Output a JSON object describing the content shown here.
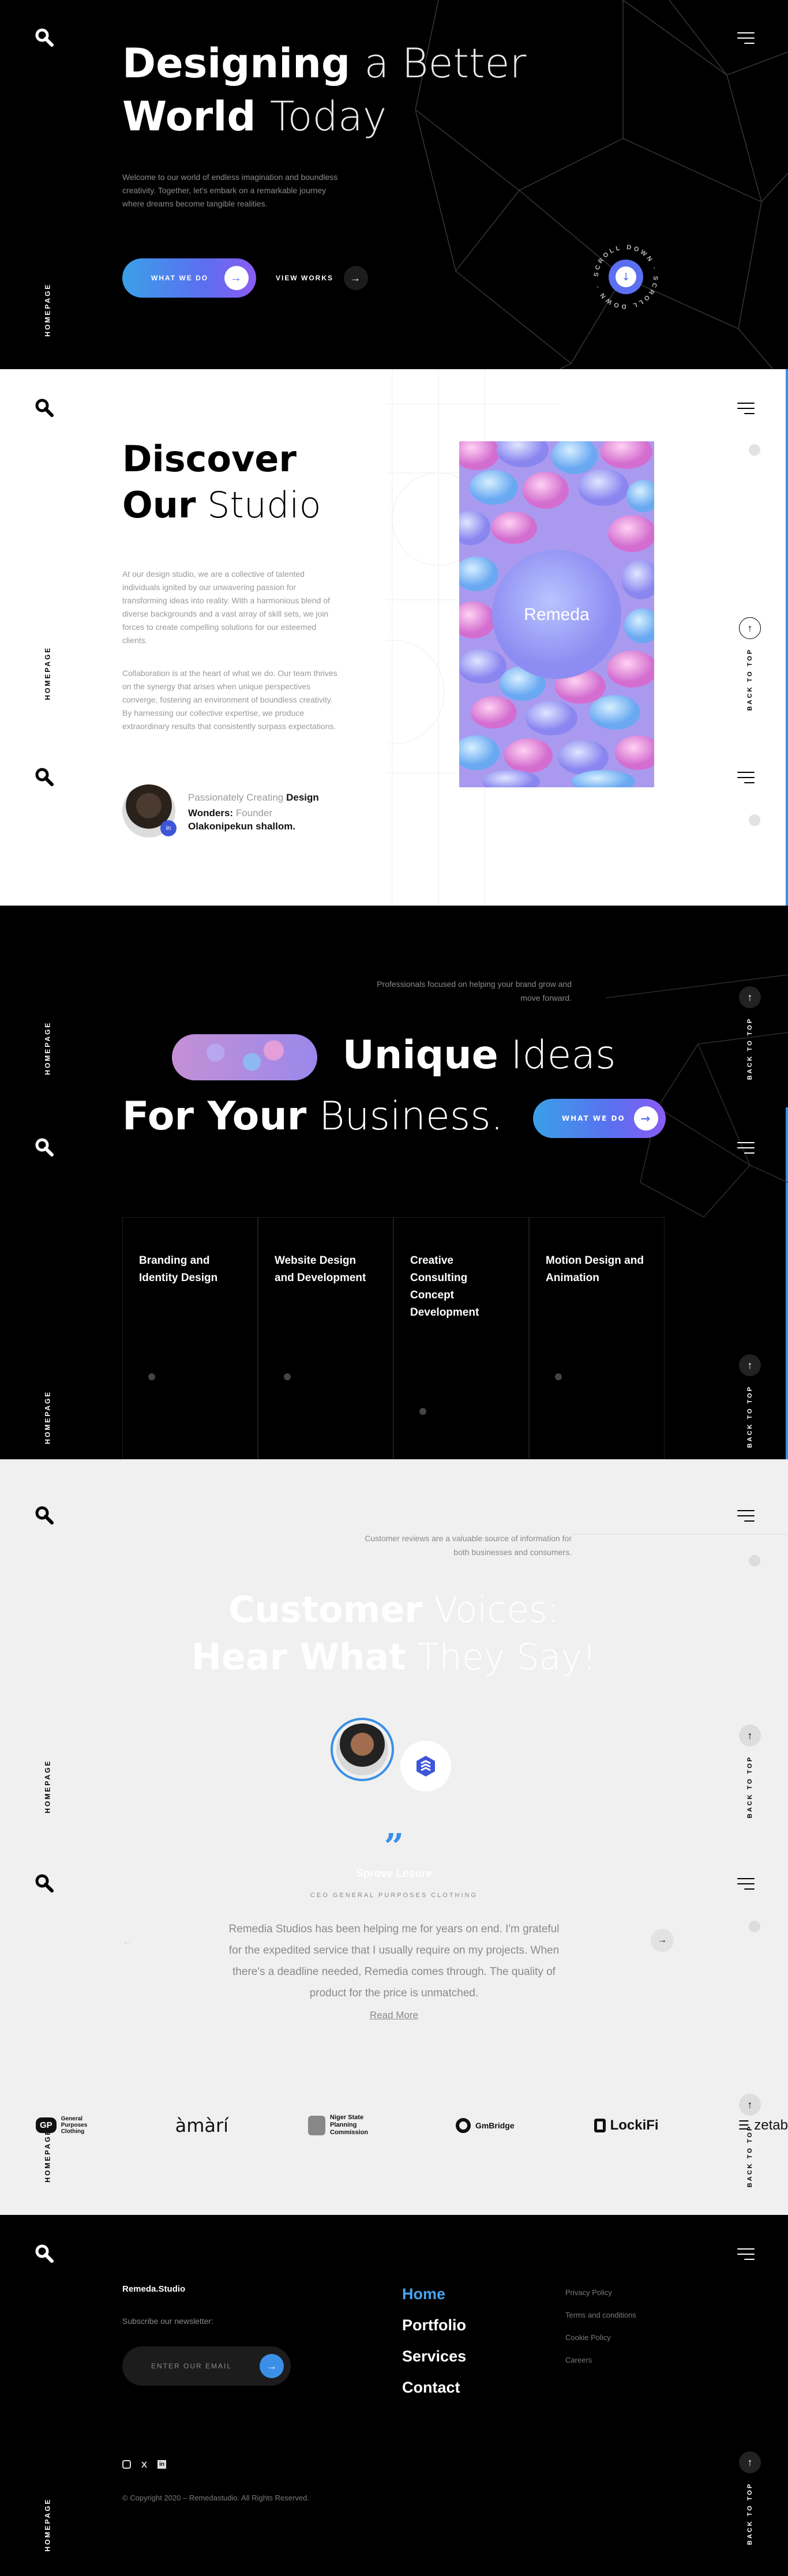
{
  "hero": {
    "title_bold_1": "Designing",
    "title_light_1": "a Better",
    "title_bold_2": "World",
    "title_light_2": "Today",
    "description": "Welcome to our world of endless imagination and boundless creativity. Together, let's embark on a remarkable journey where dreams become tangible realities.",
    "primary_button": "WHAT WE DO",
    "secondary_link": "VIEW WORKS",
    "scroll_badge": "SCROLL DOWN · SCROLL DOWN ·",
    "side_label": "HOMEPAGE"
  },
  "studio": {
    "title_bold_1": "Discover",
    "title_bold_2": "Our",
    "title_light_2": "Studio",
    "para1": "At our design studio, we are a collective of talented individuals ignited by our unwavering passion for transforming ideas into reality. With a harmonious blend of diverse backgrounds and a vast array of skill sets, we join forces to create compelling solutions for our esteemed clients.",
    "para2": "Collaboration is at the heart of what we do. Our team thrives on the synergy that arises when unique perspectives converge, fostering an environment of boundless creativity. By harnessing our collective expertise, we produce extraordinary results that consistently surpass expectations.",
    "founder_line_light": "Passionately Creating",
    "founder_line_bold1": "Design",
    "founder_line_bold2": "Wonders:",
    "founder_role": "Founder",
    "founder_name": "Olakonipekun shallom.",
    "founder_badge": "in",
    "product_brand": "Remeda",
    "side_label": "HOMEPAGE",
    "back_to_top": "BACK TO TOP"
  },
  "services": {
    "note": "Professionals focused on helping your brand grow and move forward.",
    "title_bold_1": "Unique",
    "title_light_1": "Ideas",
    "title_bold_2": "For Your",
    "title_light_2": "Business.",
    "button": "WHAT WE DO",
    "cards": [
      {
        "title": "Branding and Identity Design"
      },
      {
        "title": "Website Design and Development"
      },
      {
        "title": "Creative Consulting Concept Development"
      },
      {
        "title": "Motion Design and Animation"
      }
    ],
    "side_label": "HOMEPAGE",
    "back_to_top": "BACK TO TOP"
  },
  "reviews": {
    "note": "Customer reviews are a valuable source of information for both businesses and consumers.",
    "title_bold_1": "Customer",
    "title_light_1": "Voices:",
    "title_bold_2": "Hear What",
    "title_light_2": "They Say!",
    "quote_mark": "”",
    "name": "Sprove Lesure",
    "role": "CEO GENERAL PURPOSES CLOTHING",
    "quote": "Remedia Studios has been helping me for years on end. I'm grateful for the expedited service that I usually require on my projects. When there's a deadline needed, Remedia comes through. The quality of product for the price is unmatched.",
    "read_more": "Read More",
    "side_label": "HOMEPAGE",
    "back_to_top": "BACK TO TOP"
  },
  "logos": [
    {
      "name": "General Purposes Clothing",
      "mark": "GP"
    },
    {
      "name": "àmàrí",
      "mark": ""
    },
    {
      "name": "Niger State Planning Commission",
      "mark": ""
    },
    {
      "name": "GmBridge",
      "mark": ""
    },
    {
      "name": "LockiFi",
      "mark": ""
    },
    {
      "name": "zetab",
      "mark": ""
    }
  ],
  "footer": {
    "brand": "Remeda.Studio",
    "subscribe": "Subscribe our newsletter:",
    "email_placeholder": "ENTER OUR EMAIL",
    "nav": [
      "Home",
      "Portfolio",
      "Services",
      "Contact"
    ],
    "legal": [
      "Privacy Policy",
      "Terms and conditions",
      "Cookie Policy",
      "Careers"
    ],
    "copyright": "© Copyright 2020 – Remedastudio. All Rights Reserved.",
    "side_label": "HOMEPAGE",
    "back_to_top": "BACK TO TOP"
  },
  "colors": {
    "accent": "#3b8fe6",
    "dark": "#000000",
    "light": "#f0f0f0"
  }
}
